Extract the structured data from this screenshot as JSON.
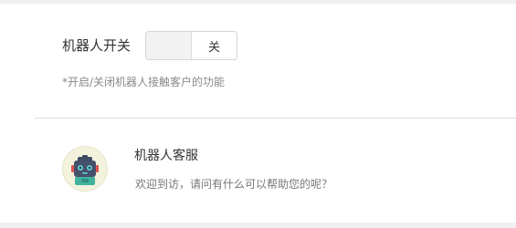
{
  "robot_switch": {
    "label": "机器人开关",
    "state_text": "关",
    "enabled": false
  },
  "hint_text": "*开启/关闭机器人接触客户的功能",
  "bot_profile": {
    "avatar_icon": "robot-icon",
    "name": "机器人客服",
    "greeting": "欢迎到访，请问有什么可以帮助您的呢？"
  }
}
